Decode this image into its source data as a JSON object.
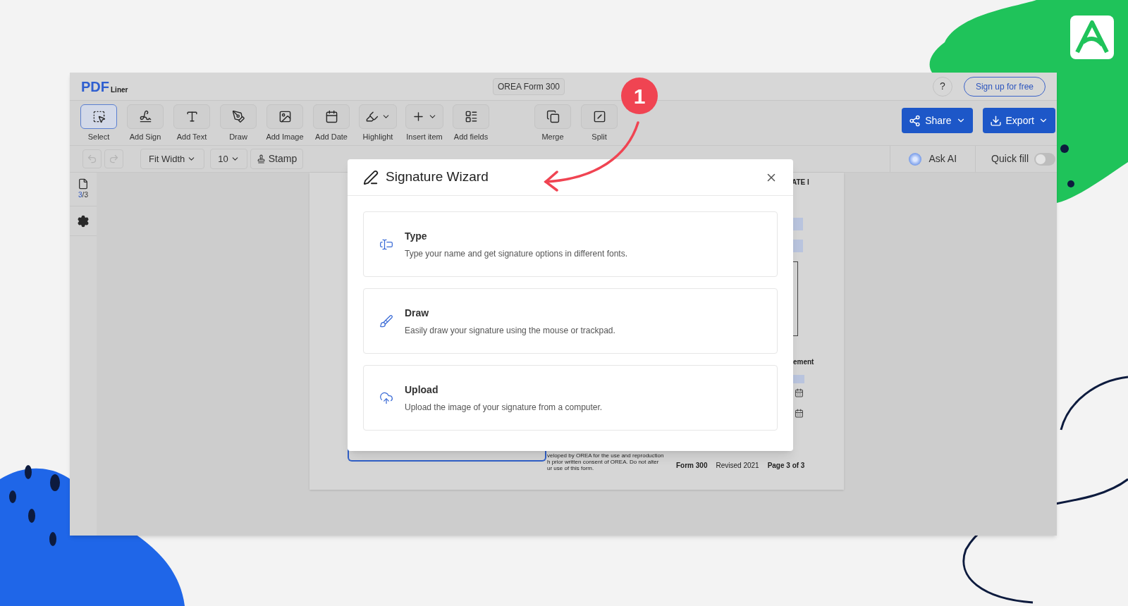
{
  "app": {
    "logo": {
      "main": "PDF",
      "sub": "Liner"
    },
    "document_title": "OREA Form 300",
    "help": "?",
    "signup": "Sign up for free"
  },
  "toolbar": {
    "tools": [
      {
        "label": "Select",
        "selected": true,
        "caret": false
      },
      {
        "label": "Add Sign",
        "selected": false,
        "caret": false
      },
      {
        "label": "Add Text",
        "selected": false,
        "caret": false
      },
      {
        "label": "Draw",
        "selected": false,
        "caret": false
      },
      {
        "label": "Add Image",
        "selected": false,
        "caret": false
      },
      {
        "label": "Add Date",
        "selected": false,
        "caret": false
      },
      {
        "label": "Highlight",
        "selected": false,
        "caret": true
      },
      {
        "label": "Insert item",
        "selected": false,
        "caret": true
      },
      {
        "label": "Add fields",
        "selected": false,
        "caret": false
      }
    ],
    "page_tools": [
      {
        "label": "Merge",
        "selected": false
      },
      {
        "label": "Split",
        "selected": false
      }
    ],
    "actions": [
      "Share",
      "Export"
    ]
  },
  "subbar": {
    "history": [
      {
        "kind": "undo",
        "disabled": true
      },
      {
        "kind": "redo",
        "disabled": true
      }
    ],
    "zoom": "Fit Width",
    "font_size": "10",
    "stamp": "Stamp",
    "ask_ai": "Ask AI",
    "quick_fill": {
      "label": "Quick fill",
      "on": false
    }
  },
  "sidebar": {
    "page": "3",
    "pages": "/3"
  },
  "document": {
    "corner_texts": [
      "ATE I",
      "ement"
    ],
    "fine_print": [
      "veloped by OREA for the use and reproduction",
      "h prior written consent of OREA. Do not alter",
      "ur use of this form."
    ],
    "footer": [
      {
        "text": "Form 300",
        "bold": true
      },
      {
        "text": "Revised 2021",
        "bold": false
      },
      {
        "text": "Page 3 of 3",
        "bold": true
      }
    ]
  },
  "modal": {
    "title": "Signature Wizard",
    "options": [
      {
        "kind": "type",
        "title": "Type",
        "description": "Type your name and get signature options in different fonts."
      },
      {
        "kind": "draw",
        "title": "Draw",
        "description": "Easily draw your signature using the mouse or trackpad."
      },
      {
        "kind": "upload",
        "title": "Upload",
        "description": "Upload the image of your signature from a computer."
      }
    ]
  },
  "callout": {
    "number": "1"
  }
}
